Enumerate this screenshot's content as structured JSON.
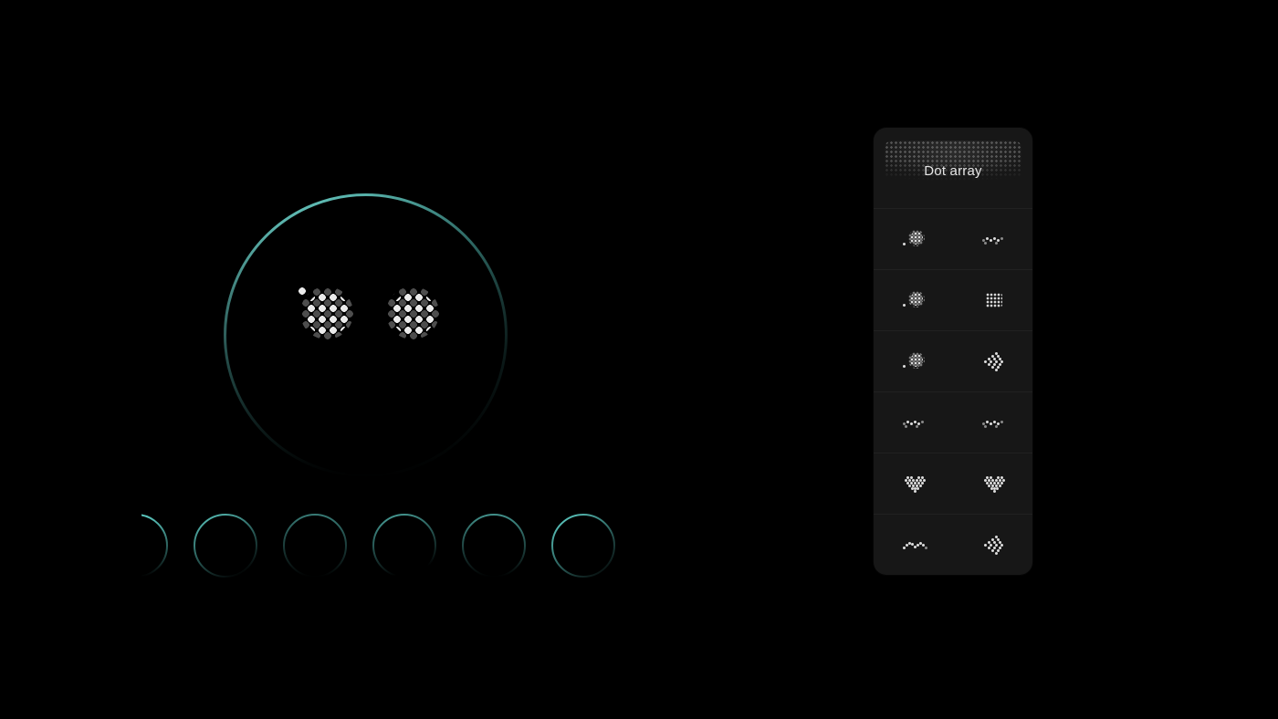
{
  "colors": {
    "ring": "#6cded5",
    "dot": "#ebebeb"
  },
  "panel": {
    "title": "Dot array",
    "rows": [
      {
        "left": "eye-cluster",
        "right": "dash-wave"
      },
      {
        "left": "eye-cluster",
        "right": "rect-cluster"
      },
      {
        "left": "eye-cluster",
        "right": "arrow-left"
      },
      {
        "left": "dash-wave",
        "right": "dash-wave"
      },
      {
        "left": "heart",
        "right": "heart"
      },
      {
        "left": "arc-wave",
        "right": "arrow-left"
      }
    ]
  },
  "strip": {
    "count": 6
  }
}
